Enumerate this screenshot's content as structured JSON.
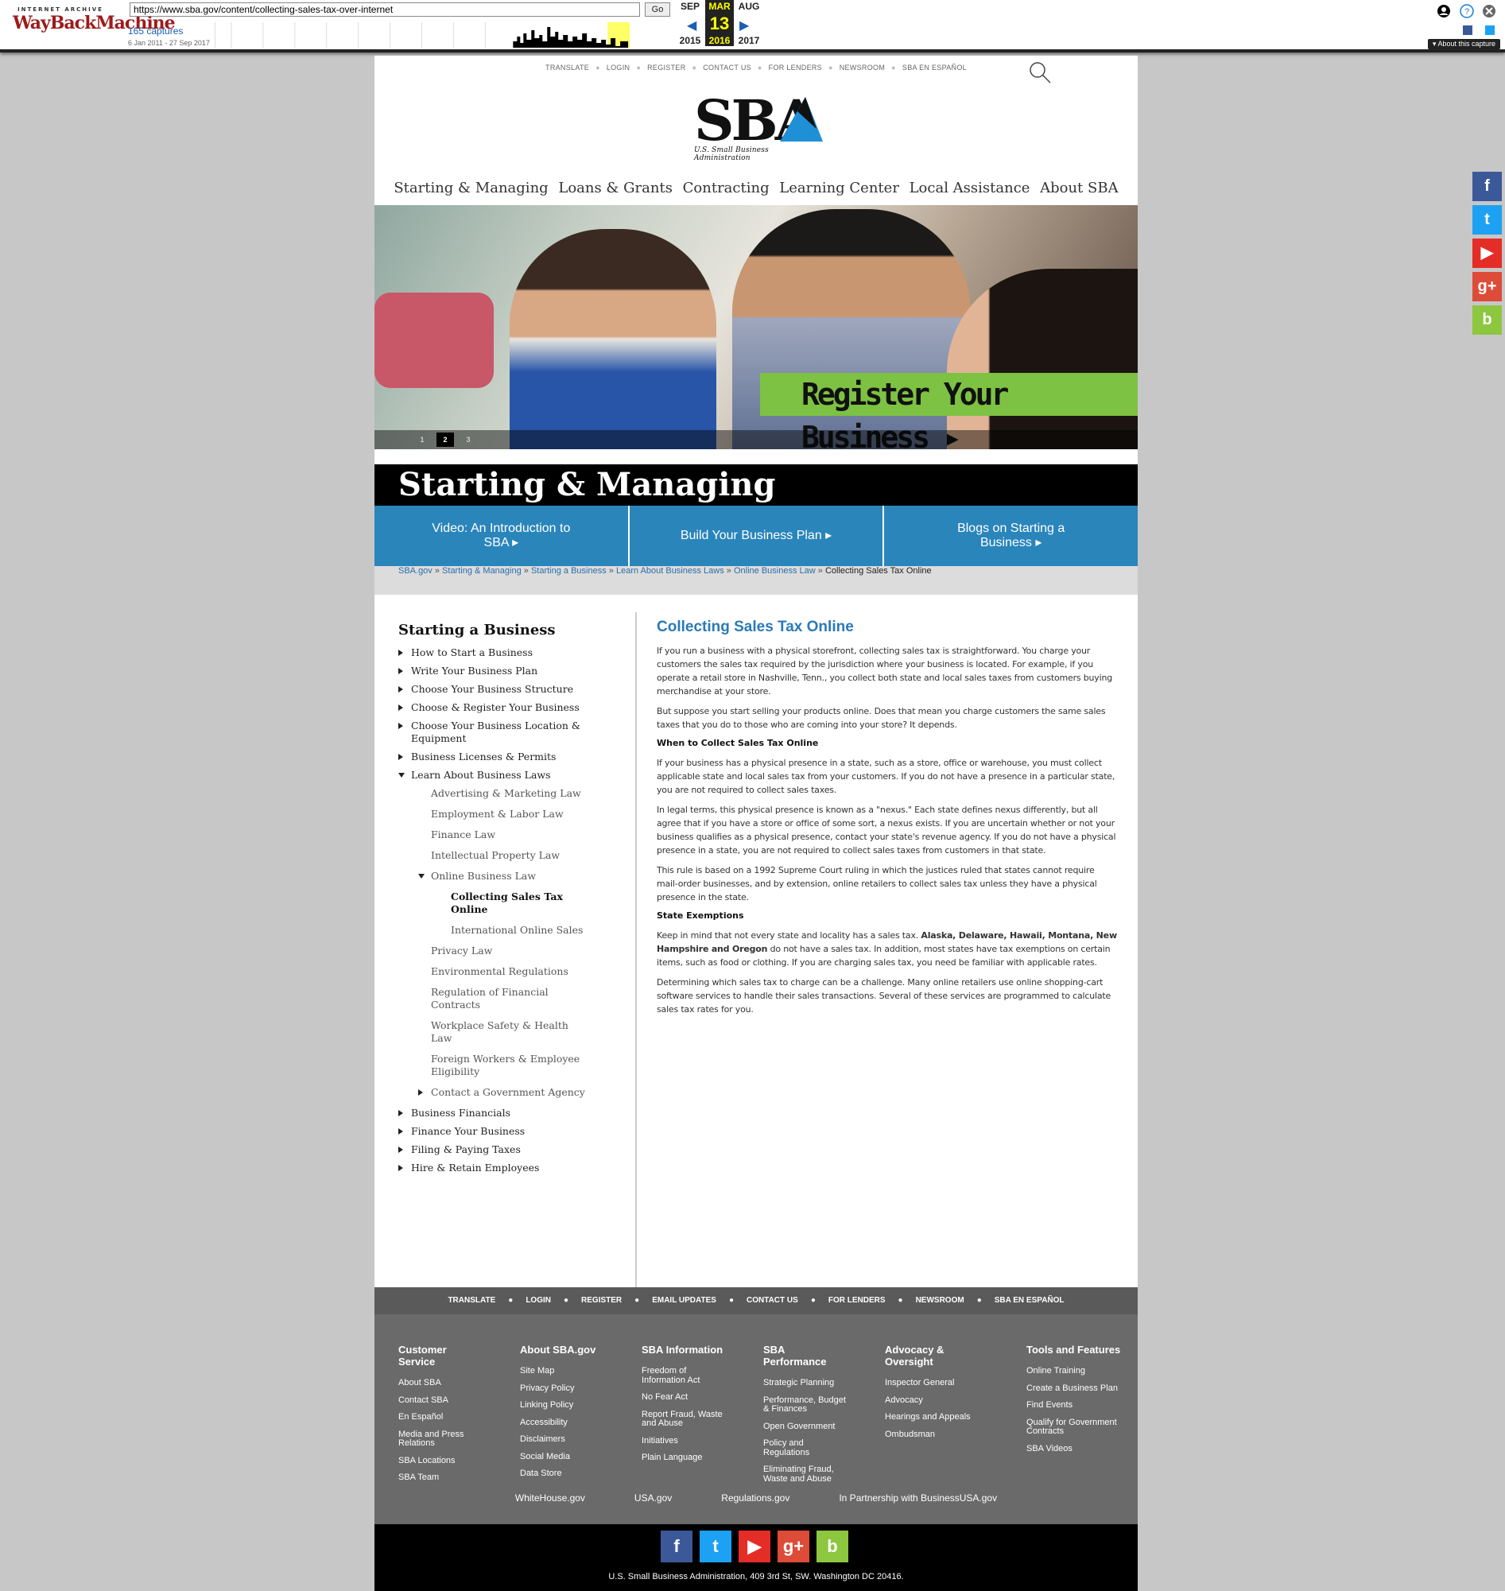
{
  "wayback": {
    "logo_top": "INTERNET ARCHIVE",
    "logo_main": "WayBackMachine",
    "url": "https://www.sba.gov/content/collecting-sales-tax-over-internet",
    "go": "Go",
    "captures": "165 captures",
    "range": "6 Jan 2011 - 27 Sep 2017",
    "months": [
      {
        "m": "SEP",
        "d": "",
        "y": "2015"
      },
      {
        "m": "MAR",
        "d": "13",
        "y": "2016"
      },
      {
        "m": "AUG",
        "d": "",
        "y": "2017"
      }
    ],
    "about": "About this capture"
  },
  "utility_nav": [
    "TRANSLATE",
    "LOGIN",
    "REGISTER",
    "CONTACT US",
    "FOR LENDERS",
    "NEWSROOM",
    "SBA EN ESPAÑOL"
  ],
  "logo": {
    "mark": "SBA",
    "subtitle": "U.S. Small Business Administration"
  },
  "main_nav": [
    "Starting & Managing",
    "Loans & Grants",
    "Contracting",
    "Learning Center",
    "Local Assistance",
    "About SBA"
  ],
  "hero": {
    "cta": "Register Your Business ▸",
    "slides": [
      "1",
      "2",
      "3"
    ],
    "active_slide": 2
  },
  "section_title": "Starting & Managing",
  "promo": [
    "Video: An Introduction to SBA ▸",
    "Build Your Business Plan ▸",
    "Blogs on Starting a Business ▸"
  ],
  "breadcrumb": {
    "links": [
      "SBA.gov",
      "Starting & Managing",
      "Starting a Business",
      "Learn About Business Laws",
      "Online Business Law"
    ],
    "current": "Collecting Sales Tax Online",
    "sep": " » "
  },
  "sidebar": {
    "title": "Starting a Business",
    "items": [
      {
        "label": "How to Start a Business",
        "level": 0,
        "tri": "right"
      },
      {
        "label": "Write Your Business Plan",
        "level": 0,
        "tri": "right"
      },
      {
        "label": "Choose Your Business Structure",
        "level": 0,
        "tri": "right"
      },
      {
        "label": "Choose & Register Your Business",
        "level": 0,
        "tri": "right"
      },
      {
        "label": "Choose Your Business Location & Equipment",
        "level": 0,
        "tri": "right"
      },
      {
        "label": "Business Licenses & Permits",
        "level": 0,
        "tri": "right"
      },
      {
        "label": "Learn About Business Laws",
        "level": 0,
        "tri": "down"
      },
      {
        "label": "Advertising & Marketing Law",
        "level": 1,
        "tri": ""
      },
      {
        "label": "Employment & Labor Law",
        "level": 1,
        "tri": ""
      },
      {
        "label": "Finance Law",
        "level": 1,
        "tri": ""
      },
      {
        "label": "Intellectual Property Law",
        "level": 1,
        "tri": ""
      },
      {
        "label": "Online Business Law",
        "level": 1,
        "tri": "down"
      },
      {
        "label": "Collecting Sales Tax Online",
        "level": 2,
        "tri": "",
        "active": true
      },
      {
        "label": "International Online Sales",
        "level": 2,
        "tri": ""
      },
      {
        "label": "Privacy Law",
        "level": 1,
        "tri": ""
      },
      {
        "label": "Environmental Regulations",
        "level": 1,
        "tri": ""
      },
      {
        "label": "Regulation of Financial Contracts",
        "level": 1,
        "tri": ""
      },
      {
        "label": "Workplace Safety & Health Law",
        "level": 1,
        "tri": ""
      },
      {
        "label": "Foreign Workers & Employee Eligibility",
        "level": 1,
        "tri": ""
      },
      {
        "label": "Contact a Government Agency",
        "level": 1,
        "tri": "right"
      },
      {
        "label": "Business Financials",
        "level": 0,
        "tri": "right"
      },
      {
        "label": "Finance Your Business",
        "level": 0,
        "tri": "right"
      },
      {
        "label": "Filing & Paying Taxes",
        "level": 0,
        "tri": "right"
      },
      {
        "label": "Hire & Retain Employees",
        "level": 0,
        "tri": "right"
      }
    ]
  },
  "article": {
    "title": "Collecting Sales Tax Online",
    "p1": "If you run a business with a physical storefront, collecting sales tax is straightforward. You charge your customers the sales tax required by the jurisdiction where your business is located. For example, if you operate a retail store in Nashville, Tenn., you collect both state and local sales taxes from customers buying merchandise at your store.",
    "p2": "But suppose you start selling your products online. Does that mean you charge customers the same sales taxes that you do to those who are coming into your store? It depends.",
    "h_when": "When to Collect Sales Tax Online",
    "p3": "If your business has a physical presence in a state, such as a store, office or warehouse, you must collect applicable state and local sales tax from your customers. If you do not have a presence in a particular state, you are not required to collect sales taxes.",
    "p4": "In legal terms, this physical presence is known as a \"nexus.\" Each state defines nexus differently, but all agree that if you have a store or office of some sort, a nexus exists. If you are uncertain whether or not your business qualifies as a physical presence, contact your state's revenue agency. If you do not have a physical presence in a state, you are not required to collect sales taxes from customers in that state.",
    "p5": "This rule is based on a 1992 Supreme Court ruling in which the justices ruled that states cannot require mail-order businesses, and by extension, online retailers to collect sales tax unless they have a physical presence in the state.",
    "h_exempt": "State Exemptions",
    "p6_pre": "Keep in mind that not every state and locality has a sales tax. ",
    "p6_bold": "Alaska, Delaware, Hawaii, Montana, New Hampshire and Oregon",
    "p6_post": " do not have a sales tax. In addition, most states have tax exemptions on certain items, such as food or clothing. If you are charging sales tax, you need be familiar with applicable rates.",
    "p7": "Determining which sales tax to charge can be a challenge. Many online retailers use online shopping-cart software services to handle their sales transactions. Several of these services are programmed to calculate sales tax rates for you."
  },
  "footer_nav": [
    "TRANSLATE",
    "LOGIN",
    "REGISTER",
    "EMAIL UPDATES",
    "CONTACT US",
    "FOR LENDERS",
    "NEWSROOM",
    "SBA EN ESPAÑOL"
  ],
  "footer_cols": [
    {
      "title": "Customer Service",
      "links": [
        "About SBA",
        "Contact SBA",
        "En Español",
        "Media and Press Relations",
        "SBA Locations",
        "SBA Team"
      ]
    },
    {
      "title": "About SBA.gov",
      "links": [
        "Site Map",
        "Privacy Policy",
        "Linking Policy",
        "Accessibility",
        "Disclaimers",
        "Social Media",
        "Data Store"
      ]
    },
    {
      "title": "SBA Information",
      "links": [
        "Freedom of Information Act",
        "No Fear Act",
        "Report Fraud, Waste and Abuse",
        "Initiatives",
        "Plain Language"
      ]
    },
    {
      "title": "SBA Performance",
      "links": [
        "Strategic Planning",
        "Performance, Budget & Finances",
        "Open Government",
        "Policy and Regulations",
        "Eliminating Fraud, Waste and Abuse"
      ]
    },
    {
      "title": "Advocacy & Oversight",
      "links": [
        "Inspector General",
        "Advocacy",
        "Hearings and Appeals",
        "Ombudsman"
      ]
    },
    {
      "title": "Tools and Features",
      "links": [
        "Online Training",
        "Create a Business Plan",
        "Find Events",
        "Qualify for Government Contracts",
        "SBA Videos"
      ]
    }
  ],
  "footer_links": [
    "WhiteHouse.gov",
    "USA.gov",
    "Regulations.gov",
    "In Partnership with BusinessUSA.gov"
  ],
  "social": [
    {
      "icon": "facebook-icon",
      "glyph": "f",
      "color": "#3b5998"
    },
    {
      "icon": "twitter-icon",
      "glyph": "t",
      "color": "#1da1f2"
    },
    {
      "icon": "youtube-icon",
      "glyph": "▶",
      "color": "#e52d27"
    },
    {
      "icon": "google-plus-icon",
      "glyph": "g+",
      "color": "#dd4b39"
    },
    {
      "icon": "blog-icon",
      "glyph": "b",
      "color": "#8dc63f"
    }
  ],
  "address": "U.S. Small Business Administration, 409 3rd St, SW. Washington DC 20416.",
  "colors": {
    "accent": "#2a85bb",
    "cta_green": "#7dc242",
    "title_blue": "#2a7ab7"
  }
}
